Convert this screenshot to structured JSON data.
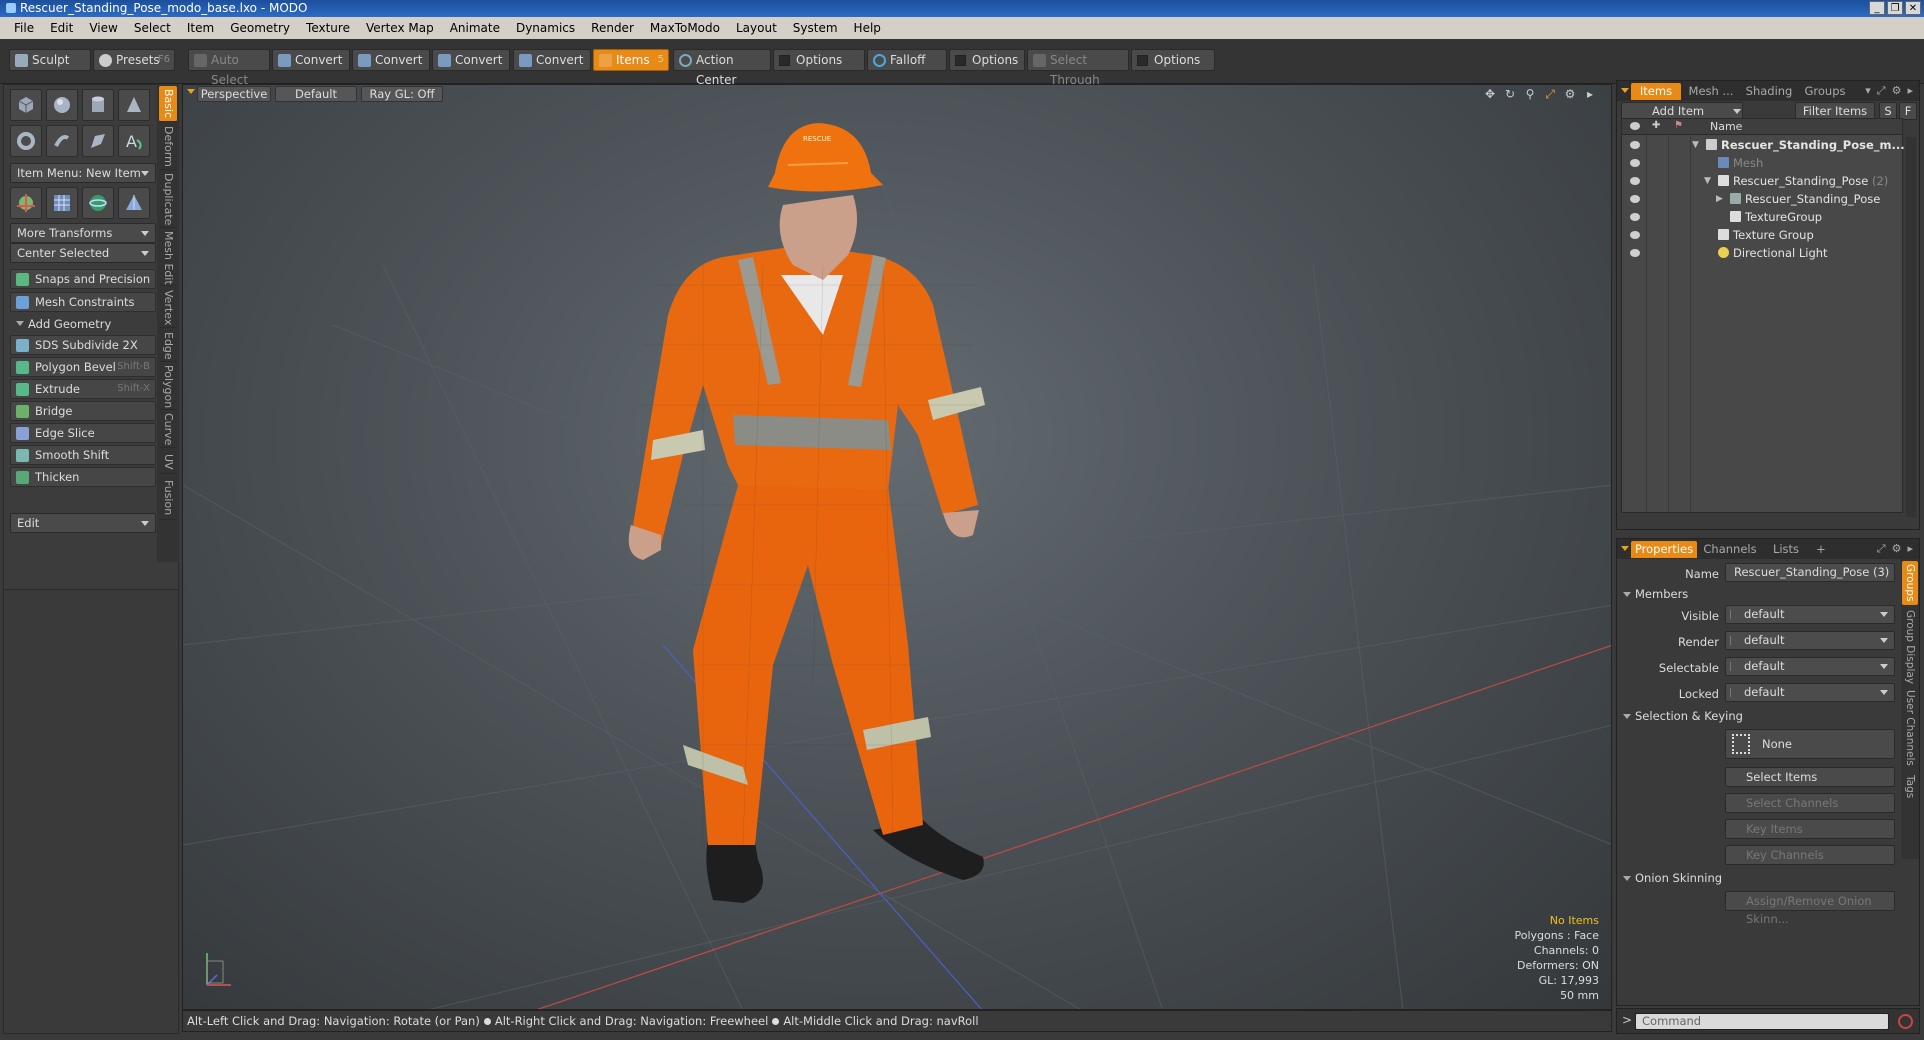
{
  "window": {
    "title": "Rescuer_Standing_Pose_modo_base.lxo - MODO",
    "controls": [
      "_",
      "❐",
      "✕"
    ]
  },
  "menu": [
    "File",
    "Edit",
    "View",
    "Select",
    "Item",
    "Geometry",
    "Texture",
    "Vertex Map",
    "Animate",
    "Dynamics",
    "Render",
    "MaxToModo",
    "Layout",
    "System",
    "Help"
  ],
  "toolbar": {
    "sculpt": "Sculpt",
    "presets": "Presets",
    "presets_shortcut": "F6",
    "auto_select": "Auto Select",
    "convert1": "Convert",
    "convert2": "Convert",
    "convert3": "Convert",
    "convert4": "Convert",
    "items": "Items",
    "items_shortcut": "5",
    "action_center": "Action Center",
    "options1": "Options",
    "falloff": "Falloff",
    "options2": "Options",
    "select_through": "Select Through",
    "options3": "Options"
  },
  "left": {
    "item_menu": "Item Menu: New Item",
    "more_transforms": "More Transforms",
    "center_selected": "Center Selected",
    "snaps": "Snaps and Precision",
    "mesh_constraints": "Mesh Constraints",
    "add_geometry": "Add Geometry",
    "tools": [
      {
        "label": "SDS Subdivide 2X",
        "shortcut": ""
      },
      {
        "label": "Polygon Bevel",
        "shortcut": "Shift-B"
      },
      {
        "label": "Extrude",
        "shortcut": "Shift-X"
      },
      {
        "label": "Bridge",
        "shortcut": ""
      },
      {
        "label": "Edge Slice",
        "shortcut": ""
      },
      {
        "label": "Smooth Shift",
        "shortcut": ""
      },
      {
        "label": "Thicken",
        "shortcut": ""
      }
    ],
    "edit": "Edit",
    "vtabs": [
      "Basic",
      "Deform",
      "Duplicate",
      "Mesh Edit",
      "Vertex",
      "Edge",
      "Polygon",
      "Curve",
      "UV",
      "Fusion"
    ]
  },
  "viewport": {
    "view": "Perspective",
    "shading": "Default",
    "raygl": "Ray GL: Off",
    "helmet_text": "RESCUE",
    "stats": {
      "items": "No Items",
      "polygons": "Polygons : Face",
      "channels": "Channels: 0",
      "deformers": "Deformers: ON",
      "gl": "GL: 17,993",
      "focal": "50 mm"
    }
  },
  "status": {
    "hint1": "Alt-Left Click and Drag: Navigation: Rotate (or Pan)",
    "hint2": "Alt-Right Click and Drag: Navigation: Freewheel",
    "hint3": "Alt-Middle Click and Drag: navRoll"
  },
  "items_panel": {
    "tabs": [
      "Items",
      "Mesh ...",
      "Shading",
      "Groups"
    ],
    "add_item": "Add Item",
    "filter": "Filter Items",
    "s": "S",
    "f": "F",
    "name_col": "Name",
    "rows": [
      {
        "label": "Rescuer_Standing_Pose_m...",
        "count": ""
      },
      {
        "label": "Mesh",
        "count": ""
      },
      {
        "label": "Rescuer_Standing_Pose",
        "count": "(2)"
      },
      {
        "label": "Rescuer_Standing_Pose",
        "count": ""
      },
      {
        "label": "TextureGroup",
        "count": ""
      },
      {
        "label": "Texture Group",
        "count": ""
      },
      {
        "label": "Directional Light",
        "count": ""
      }
    ]
  },
  "properties": {
    "tabs": [
      "Properties",
      "Channels",
      "Lists",
      "+"
    ],
    "name_label": "Name",
    "name_value": "Rescuer_Standing_Pose (3)",
    "members": "Members",
    "visible_label": "Visible",
    "visible": "default",
    "render_label": "Render",
    "render": "default",
    "selectable_label": "Selectable",
    "selectable": "default",
    "locked_label": "Locked",
    "locked": "default",
    "sel_keying": "Selection & Keying",
    "none": "None",
    "select_items": "Select Items",
    "select_channels": "Select Channels",
    "key_items": "Key Items",
    "key_channels": "Key Channels",
    "onion": "Onion Skinning",
    "assign_onion": "Assign/Remove Onion Skinn...",
    "vtabs": [
      "Groups",
      "Group Display",
      "User Channels",
      "Tags"
    ]
  },
  "command": {
    "placeholder": "Command",
    "prompt": ">"
  }
}
